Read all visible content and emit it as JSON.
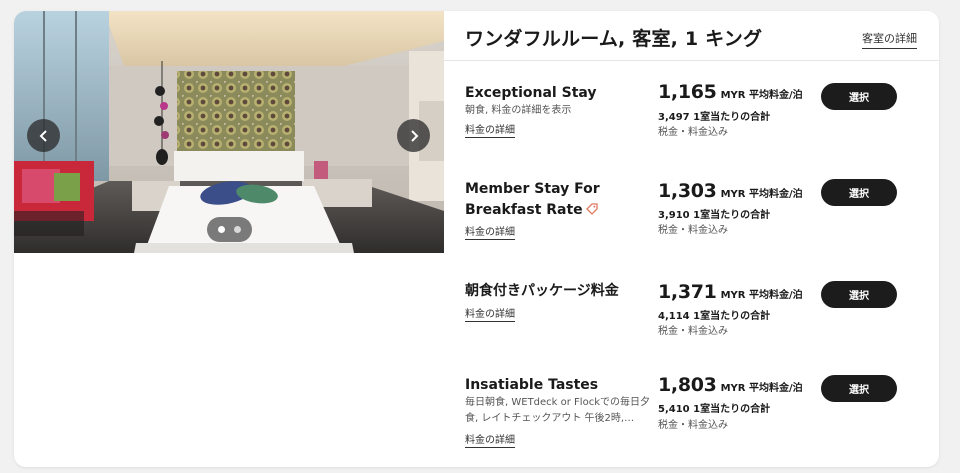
{
  "room": {
    "title": "ワンダフルルーム, 客室, 1 キング",
    "details_link": "客室の詳細"
  },
  "gallery": {
    "prev_icon": "chevron-left-icon",
    "next_icon": "chevron-right-icon",
    "slide_count": 2,
    "active_slide": 1
  },
  "rates": [
    {
      "name": "Exceptional Stay",
      "has_tag_icon": false,
      "description": "朝食, 料金の詳細を表示",
      "details_link": "料金の詳細",
      "price": "1,165",
      "unit": "MYR 平均料金/泊",
      "total": "3,497 1室当たりの合計",
      "tax": "税金・料金込み",
      "select_label": "選択"
    },
    {
      "name": "Member Stay For Breakfast Rate",
      "has_tag_icon": true,
      "description": "",
      "details_link": "料金の詳細",
      "price": "1,303",
      "unit": "MYR 平均料金/泊",
      "total": "3,910 1室当たりの合計",
      "tax": "税金・料金込み",
      "select_label": "選択"
    },
    {
      "name": "朝食付きパッケージ料金",
      "has_tag_icon": false,
      "description": "",
      "details_link": "料金の詳細",
      "price": "1,371",
      "unit": "MYR 平均料金/泊",
      "total": "4,114 1室当たりの合計",
      "tax": "税金・料金込み",
      "select_label": "選択"
    },
    {
      "name": "Insatiable Tastes",
      "has_tag_icon": false,
      "description": "毎日朝食, WETdeck or Flockでの毎日夕食, レイトチェックアウト 午後2時,…",
      "details_link": "料金の詳細",
      "price": "1,803",
      "unit": "MYR 平均料金/泊",
      "total": "5,410 1室当たりの合計",
      "tax": "税金・料金込み",
      "select_label": "選択"
    }
  ],
  "colors": {
    "button_bg": "#1c1c1c",
    "page_bg": "#f1f1f1",
    "tag_icon": "#e07a5f"
  }
}
